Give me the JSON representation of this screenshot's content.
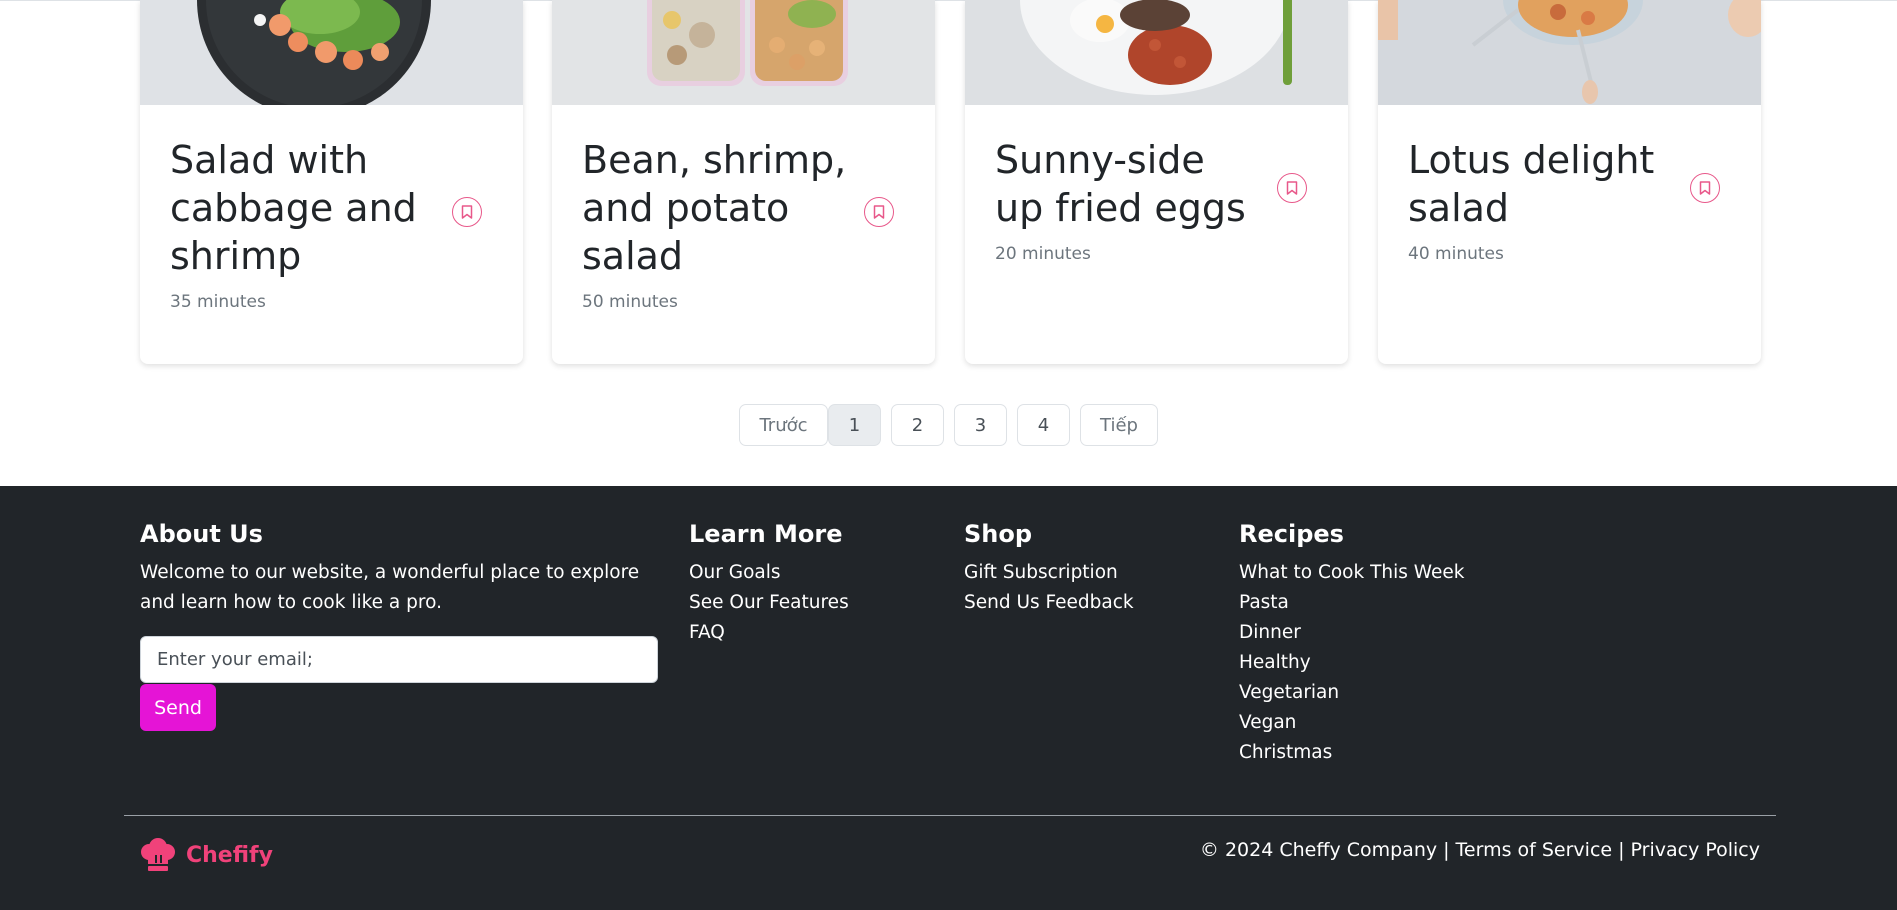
{
  "cards": [
    {
      "title": "Salad with cabbage and shrimp",
      "time": "35 minutes"
    },
    {
      "title": "Bean, shrimp, and potato salad",
      "time": "50 minutes"
    },
    {
      "title": "Sunny-side up fried eggs",
      "time": "20 minutes"
    },
    {
      "title": "Lotus delight salad",
      "time": "40 minutes"
    }
  ],
  "card_icon": "bookmark-icon",
  "pagination": {
    "prev": "Trước",
    "pages": [
      "1",
      "2",
      "3",
      "4"
    ],
    "next": "Tiếp",
    "current": "1"
  },
  "footer": {
    "about": {
      "heading": "About Us",
      "text": "Welcome to our website, a wonderful place to explore and learn how to cook like a pro.",
      "email_placeholder": "Enter your email;",
      "send_label": "Send"
    },
    "learn_more": {
      "heading": "Learn More",
      "links": [
        "Our Goals",
        "See Our Features",
        "FAQ"
      ]
    },
    "shop": {
      "heading": "Shop",
      "links": [
        "Gift Subscription",
        "Send Us Feedback"
      ]
    },
    "recipes": {
      "heading": "Recipes",
      "links": [
        "What to Cook This Week",
        "Pasta",
        "Dinner",
        "Healthy",
        "Vegetarian",
        "Vegan",
        "Christmas"
      ]
    },
    "brand": "Chefify",
    "copyright": "© 2024 Cheffy Company",
    "separator": "|",
    "terms": "Terms of Service",
    "privacy": "Privacy Policy"
  },
  "colors": {
    "accent": "#e514d6",
    "brand": "#f0427a",
    "bookmark": "#e8588a",
    "footer_bg": "#212529"
  }
}
